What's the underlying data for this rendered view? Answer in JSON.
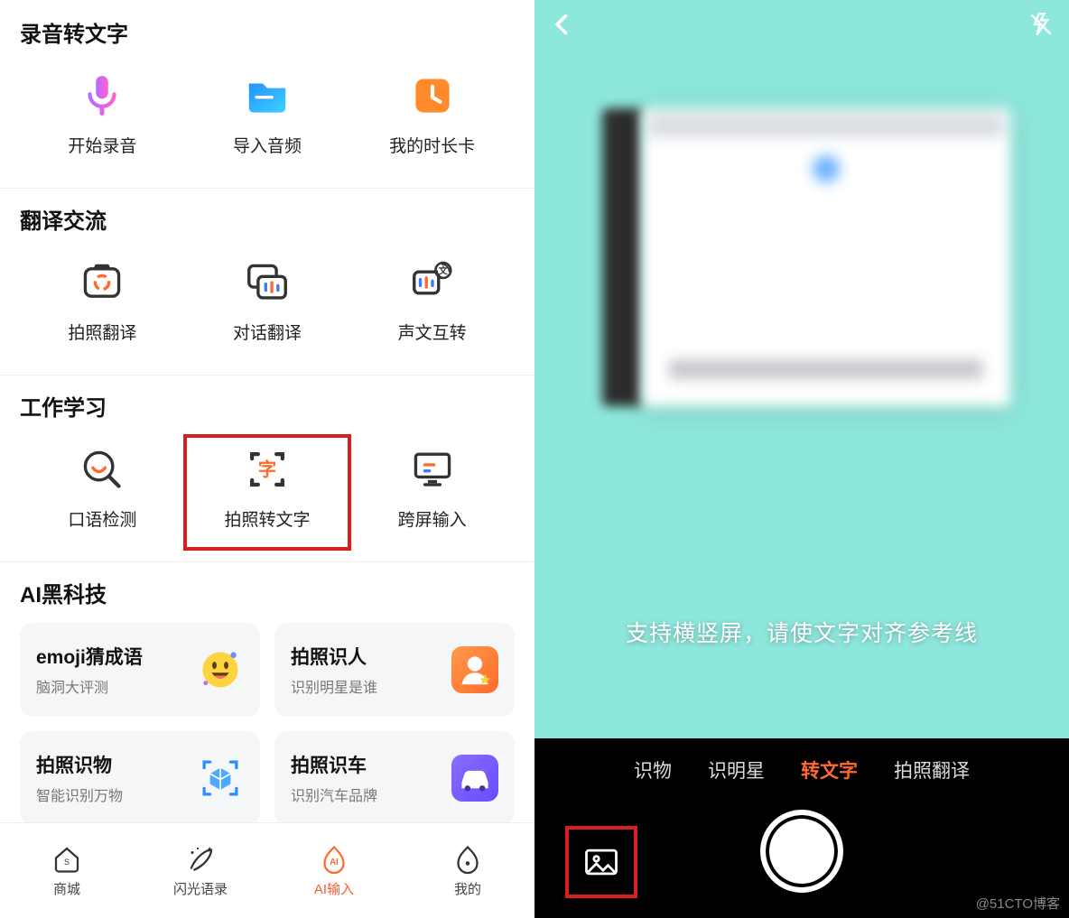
{
  "left": {
    "sections": [
      {
        "title": "录音转文字",
        "items": [
          "开始录音",
          "导入音频",
          "我的时长卡"
        ]
      },
      {
        "title": "翻译交流",
        "items": [
          "拍照翻译",
          "对话翻译",
          "声文互转"
        ]
      },
      {
        "title": "工作学习",
        "items": [
          "口语检测",
          "拍照转文字",
          "跨屏输入"
        ]
      },
      {
        "title": "AI黑科技",
        "cards": [
          {
            "title": "emoji猜成语",
            "sub": "脑洞大评测"
          },
          {
            "title": "拍照识人",
            "sub": "识别明星是谁"
          },
          {
            "title": "拍照识物",
            "sub": "智能识别万物"
          },
          {
            "title": "拍照识车",
            "sub": "识别汽车品牌"
          }
        ]
      }
    ],
    "bottom_nav": [
      "商城",
      "闪光语录",
      "AI输入",
      "我的"
    ],
    "bottom_active_index": 2
  },
  "right": {
    "hint": "支持横竖屏，请使文字对齐参考线",
    "modes": [
      "识物",
      "识明星",
      "转文字",
      "拍照翻译"
    ],
    "active_mode_index": 2
  },
  "watermark": "@51CTO博客"
}
